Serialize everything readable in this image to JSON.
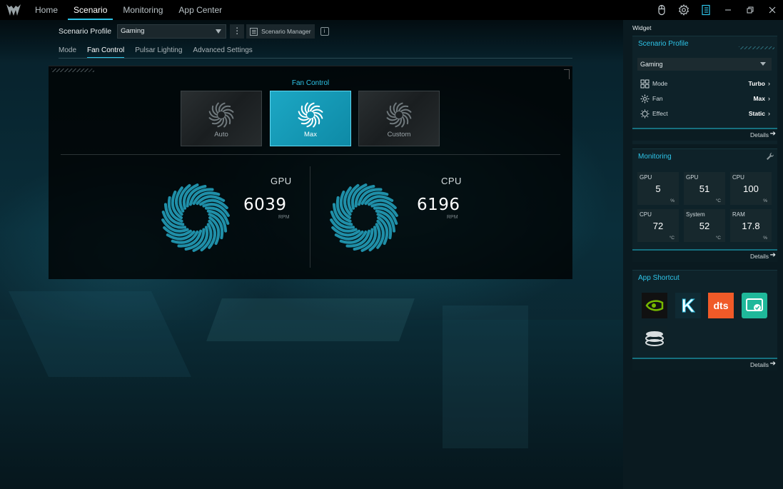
{
  "nav": {
    "tabs": [
      {
        "label": "Home"
      },
      {
        "label": "Scenario"
      },
      {
        "label": "Monitoring"
      },
      {
        "label": "App Center"
      }
    ],
    "active_tab": "Scenario",
    "icons": [
      "mouse-icon",
      "gear-icon",
      "widget-panel-icon",
      "minimize-icon",
      "restore-icon",
      "close-icon"
    ]
  },
  "profile": {
    "label": "Scenario Profile",
    "selected": "Gaming",
    "manager_label": "Scenario Manager",
    "info_glyph": "i"
  },
  "subtabs": {
    "items": [
      {
        "label": "Mode"
      },
      {
        "label": "Fan Control"
      },
      {
        "label": "Pulsar Lighting"
      },
      {
        "label": "Advanced Settings"
      }
    ],
    "active": "Fan Control"
  },
  "fan_control": {
    "title": "Fan Control",
    "modes": [
      {
        "label": "Auto"
      },
      {
        "label": "Max"
      },
      {
        "label": "Custom"
      }
    ],
    "active_mode": "Max",
    "gpu": {
      "name": "GPU",
      "rpm": "6039",
      "unit": "RPM"
    },
    "cpu": {
      "name": "CPU",
      "rpm": "6196",
      "unit": "RPM"
    }
  },
  "widget": {
    "title": "Widget",
    "scenario": {
      "title": "Scenario Profile",
      "selected": "Gaming",
      "rows": [
        {
          "label": "Mode",
          "value": "Turbo"
        },
        {
          "label": "Fan",
          "value": "Max"
        },
        {
          "label": "Effect",
          "value": "Static"
        }
      ],
      "details": "Details"
    },
    "monitoring": {
      "title": "Monitoring",
      "tiles": [
        {
          "name": "GPU",
          "value": "5",
          "unit": "%"
        },
        {
          "name": "GPU",
          "value": "51",
          "unit": "°C"
        },
        {
          "name": "CPU",
          "value": "100",
          "unit": "%"
        },
        {
          "name": "CPU",
          "value": "72",
          "unit": "°C"
        },
        {
          "name": "System",
          "value": "52",
          "unit": "°C"
        },
        {
          "name": "RAM",
          "value": "17.8",
          "unit": "%"
        }
      ],
      "details": "Details"
    },
    "shortcuts": {
      "title": "App Shortcut",
      "apps": [
        "nvidia-icon",
        "killer-icon",
        "dts-icon",
        "monitor-app-icon",
        "storage-app-icon"
      ],
      "dts_text": "dts",
      "killer_text": "K",
      "details": "Details"
    }
  },
  "colors": {
    "accent": "#2ec4e8",
    "active_mode": "#1ca7c4",
    "nvidia": "#76b900",
    "dts": "#f05a28",
    "monitor_app": "#1fb89a"
  }
}
